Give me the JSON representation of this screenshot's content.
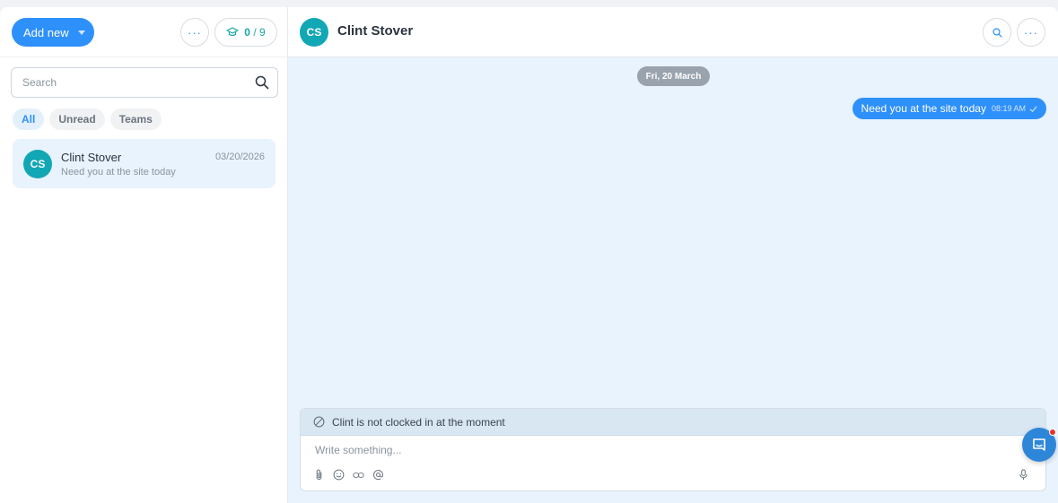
{
  "left": {
    "add_new_label": "Add new",
    "more_icon": "ellipsis-icon",
    "progress": {
      "done": "0",
      "separator": "/",
      "total": "9",
      "icon": "graduation-cap-icon"
    },
    "search": {
      "placeholder": "Search",
      "icon": "search-icon"
    },
    "filters": [
      {
        "label": "All",
        "active": true
      },
      {
        "label": "Unread",
        "active": false
      },
      {
        "label": "Teams",
        "active": false
      }
    ],
    "conversations": [
      {
        "initials": "CS",
        "name": "Clint Stover",
        "preview": "Need you at the site today",
        "date": "03/20/2026"
      }
    ]
  },
  "chat": {
    "initials": "CS",
    "title": "Clint Stover",
    "date_divider": "Fri, 20 March",
    "messages": [
      {
        "text": "Need you at the site today",
        "time": "08:19 AM",
        "status_icon": "check-icon"
      }
    ],
    "notice": "Clint is not clocked in at the moment",
    "composer_placeholder": "Write something...",
    "tool_icons": [
      "paperclip-icon",
      "emoji-icon",
      "link-icon",
      "at-sign-icon"
    ],
    "mic_icon": "microphone-icon"
  },
  "colors": {
    "primary": "#2e90fa",
    "avatar": "#12a7b5",
    "chat_bg": "#e8f3fd",
    "notice_bg": "#d9e7f3"
  }
}
